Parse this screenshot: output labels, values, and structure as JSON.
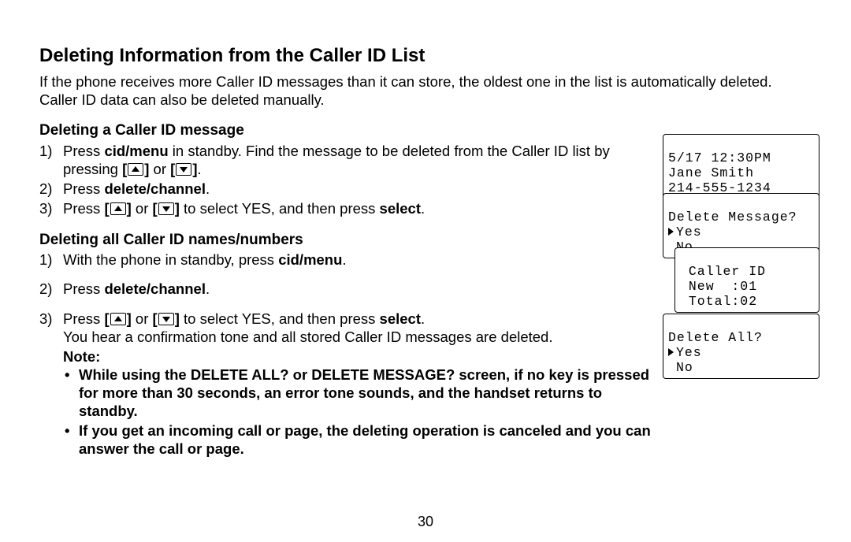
{
  "page_number": "30",
  "title": "Deleting Information from the Caller ID List",
  "intro": "If the phone receives more Caller ID messages than it can store, the oldest one in the list is automatically deleted. Caller ID data can also be deleted manually.",
  "sectionA": {
    "heading": "Deleting a Caller ID message",
    "step1_a": "Press ",
    "step1_key1": "cid/menu",
    "step1_b": " in standby. Find the message to be deleted from the Caller ID list by pressing ",
    "step1_or": " or ",
    "step1_end": ".",
    "step2_a": "Press ",
    "step2_key": "delete/channel",
    "step2_end": ".",
    "step3_a": "Press ",
    "step3_or": " or ",
    "step3_mid": " to select YES, and then press ",
    "step3_key": "select",
    "step3_end": "."
  },
  "sectionB": {
    "heading": "Deleting all Caller ID names/numbers",
    "step1_a": "With the phone in standby, press ",
    "step1_key": "cid/menu",
    "step1_end": ".",
    "step2_a": "Press ",
    "step2_key": "delete/channel",
    "step2_end": ".",
    "step3_a": "Press ",
    "step3_or": " or ",
    "step3_mid": " to select YES, and then press ",
    "step3_key": "select",
    "step3_end": ".",
    "step3_extra": "You hear a confirmation tone and all stored Caller ID messages are deleted."
  },
  "note_label": "Note:",
  "notes": {
    "n1": "While using the DELETE ALL? or DELETE MESSAGE? screen, if no key is pressed for more than 30 seconds, an error tone sounds, and the handset returns to standby.",
    "n2": "If you get an incoming call or page, the deleting operation is canceled and you can answer the call or page."
  },
  "lcd1": {
    "l1": "5/17 12:30PM",
    "l2": "Jane Smith",
    "l3": "214-555-1234"
  },
  "lcd2": {
    "l1": "Delete Message?",
    "yes": "Yes",
    "no": "No"
  },
  "lcd3": {
    "l1": " Caller ID",
    "l2": " New  :01",
    "l3": " Total:02"
  },
  "lcd4": {
    "l1": "Delete All?",
    "yes": "Yes",
    "no": "No"
  }
}
